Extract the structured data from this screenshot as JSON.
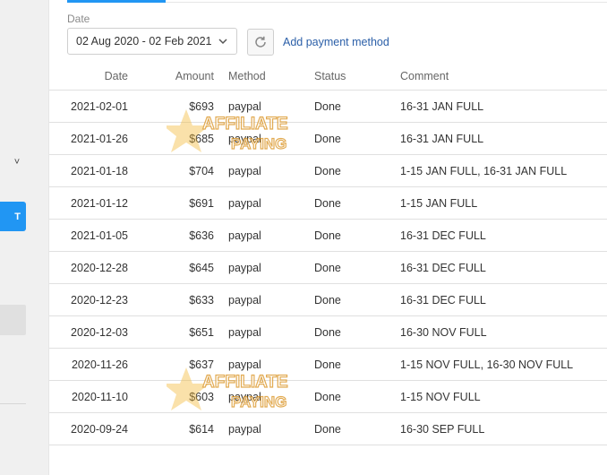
{
  "filter": {
    "date_label": "Date",
    "date_range": "02 Aug 2020 - 02 Feb 2021",
    "add_payment_label": "Add payment method"
  },
  "sidebar": {
    "chevron": "˅",
    "active_item_fragment": "T"
  },
  "table": {
    "headers": {
      "date": "Date",
      "amount": "Amount",
      "method": "Method",
      "status": "Status",
      "comment": "Comment"
    },
    "rows": [
      {
        "date": "2021-02-01",
        "amount": "$693",
        "method": "paypal",
        "status": "Done",
        "comment": "16-31 JAN FULL"
      },
      {
        "date": "2021-01-26",
        "amount": "$685",
        "method": "paypal",
        "status": "Done",
        "comment": "16-31 JAN FULL"
      },
      {
        "date": "2021-01-18",
        "amount": "$704",
        "method": "paypal",
        "status": "Done",
        "comment": "1-15 JAN FULL, 16-31 JAN FULL"
      },
      {
        "date": "2021-01-12",
        "amount": "$691",
        "method": "paypal",
        "status": "Done",
        "comment": "1-15 JAN FULL"
      },
      {
        "date": "2021-01-05",
        "amount": "$636",
        "method": "paypal",
        "status": "Done",
        "comment": "16-31 DEC FULL"
      },
      {
        "date": "2020-12-28",
        "amount": "$645",
        "method": "paypal",
        "status": "Done",
        "comment": "16-31 DEC FULL"
      },
      {
        "date": "2020-12-23",
        "amount": "$633",
        "method": "paypal",
        "status": "Done",
        "comment": "16-31 DEC FULL"
      },
      {
        "date": "2020-12-03",
        "amount": "$651",
        "method": "paypal",
        "status": "Done",
        "comment": "16-30 NOV FULL"
      },
      {
        "date": "2020-11-26",
        "amount": "$637",
        "method": "paypal",
        "status": "Done",
        "comment": "1-15 NOV FULL, 16-30 NOV FULL"
      },
      {
        "date": "2020-11-10",
        "amount": "$603",
        "method": "paypal",
        "status": "Done",
        "comment": "1-15 NOV FULL"
      },
      {
        "date": "2020-09-24",
        "amount": "$614",
        "method": "paypal",
        "status": "Done",
        "comment": "16-30 SEP FULL"
      }
    ]
  },
  "watermark": {
    "line1": "AFFILIATE",
    "line2": "PAYING"
  },
  "colors": {
    "accent": "#2196f3",
    "link": "#2b5fa8",
    "watermark_gold": "#f2b632"
  },
  "icons": {
    "refresh": "refresh-icon",
    "dropdown": "chevron-down-icon"
  }
}
